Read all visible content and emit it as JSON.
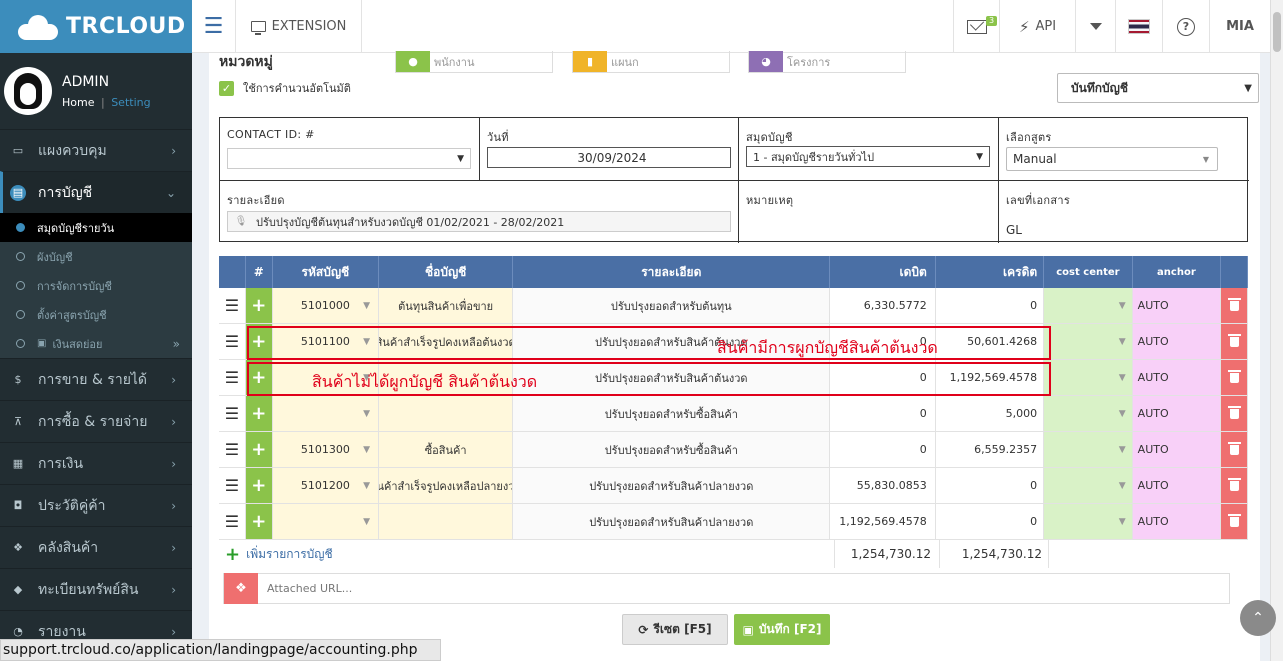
{
  "topbar": {
    "brand": "TRCLOUD",
    "extension_label": "EXTENSION",
    "mail_badge": "3",
    "api_label": "API",
    "help_glyph": "?",
    "user_short": "MIA"
  },
  "sidebar": {
    "user_name": "ADMIN",
    "home_link": "Home",
    "separator": "|",
    "setting_link": "Setting",
    "items": [
      {
        "label": "แผงควบคุม",
        "icon": "monitor-icon"
      },
      {
        "label": "การบัญชี",
        "icon": "book-icon"
      },
      {
        "label": "การขาย & รายได้",
        "icon": "dollar-icon"
      },
      {
        "label": "การซื้อ & รายจ่าย",
        "icon": "cart-icon"
      },
      {
        "label": "การเงิน",
        "icon": "calendar-icon"
      },
      {
        "label": "ประวัติคู่ค้า",
        "icon": "contact-icon"
      },
      {
        "label": "คลังสินค้า",
        "icon": "cubes-icon"
      },
      {
        "label": "ทะเบียนทรัพย์สิน",
        "icon": "diamond-icon"
      },
      {
        "label": "รายงาน",
        "icon": "report-icon"
      }
    ],
    "subitems": [
      "สมุดบัญชีรายวัน",
      "ผังบัญชี",
      "การจัดการบัญชี",
      "ตั้งค่าสูตรบัญชี",
      "เงินสดย่อย"
    ]
  },
  "form": {
    "section_title": "หมวดหมู่",
    "employee_placeholder": "พนักงาน",
    "department_placeholder": "แผนก",
    "project_placeholder": "โครงการ",
    "auto_calc_label": "ใช้การคำนวนอัตโนมัติ",
    "save_option": "บันทึกบัญชี",
    "contact_label": "CONTACT ID: #",
    "date_label": "วันที่",
    "date_value": "30/09/2024",
    "journal_label": "สมุดบัญชี",
    "journal_value": "1 - สมุดบัญชีรายวันทั่วไป",
    "formula_label": "เลือกสูตร",
    "formula_value": "Manual",
    "detail_label": "รายละเอียด",
    "detail_value": "ปรับปรุงบัญชีต้นทุนสำหรับงวดบัญชี 01/02/2021 - 28/02/2021",
    "remark_label": "หมายเหตุ",
    "docno_label": "เลขที่เอกสาร",
    "docno_value": "GL"
  },
  "table": {
    "headers": [
      "#",
      "รหัสบัญชี",
      "ชื่อบัญชี",
      "รายละเอียด",
      "เดบิต",
      "เครดิต",
      "cost center",
      "anchor"
    ],
    "rows": [
      {
        "code": "5101000",
        "name": "ต้นทุนสินค้าเพื่อขาย",
        "desc": "ปรับปรุงยอดสำหรับต้นทุน",
        "debit": "6,330.5772",
        "credit": "0",
        "anchor": "AUTO"
      },
      {
        "code": "5101100",
        "name": "สินค้าสำเร็จรูปคงเหลือต้นงวด",
        "desc": "ปรับปรุงยอดสำหรับสินค้าต้นงวด",
        "debit": "0",
        "credit": "50,601.4268",
        "anchor": "AUTO"
      },
      {
        "code": "",
        "name": "",
        "desc": "ปรับปรุงยอดสำหรับสินค้าต้นงวด",
        "debit": "0",
        "credit": "1,192,569.4578",
        "anchor": "AUTO"
      },
      {
        "code": "",
        "name": "",
        "desc": "ปรับปรุงยอดสำหรับซื้อสินค้า",
        "debit": "0",
        "credit": "5,000",
        "anchor": "AUTO"
      },
      {
        "code": "5101300",
        "name": "ซื้อสินค้า",
        "desc": "ปรับปรุงยอดสำหรับซื้อสินค้า",
        "debit": "0",
        "credit": "6,559.2357",
        "anchor": "AUTO"
      },
      {
        "code": "5101200",
        "name": "สินค้าสำเร็จรูปคงเหลือปลายงวด",
        "desc": "ปรับปรุงยอดสำหรับสินค้าปลายงวด",
        "debit": "55,830.0853",
        "credit": "0",
        "anchor": "AUTO"
      },
      {
        "code": "",
        "name": "",
        "desc": "ปรับปรุงยอดสำหรับสินค้าปลายงวด",
        "debit": "1,192,569.4578",
        "credit": "0",
        "anchor": "AUTO"
      }
    ],
    "add_row_label": "เพิ่มรายการบัญชี",
    "total_debit": "1,254,730.12",
    "total_credit": "1,254,730.12"
  },
  "annotations": {
    "linked": "สินค้ามีการผูกบัญชีสินค้าต้นงวด",
    "not_linked": "สินค้าไม่ได้ผูกบัญชี สินค้าต้นงวด"
  },
  "footer": {
    "attach_placeholder": "Attached URL...",
    "reset_label": "รีเซต [F5]",
    "save_label": "บันทึก [F2]"
  },
  "statusbar": {
    "url": "support.trcloud.co/application/landingpage/accounting.php"
  },
  "colors": {
    "brand": "#3c8dbc",
    "table_header": "#4a6fa5",
    "add_green": "#8bc34a",
    "delete_red": "#ef6f6f",
    "annotation_red": "#e0001a"
  }
}
